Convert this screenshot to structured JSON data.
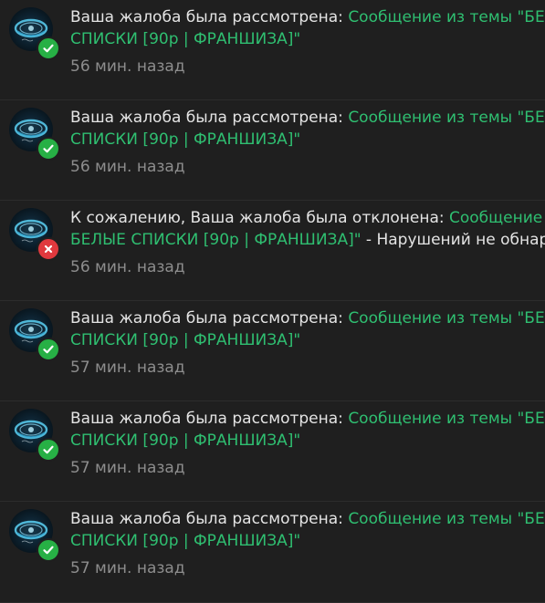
{
  "colors": {
    "background": "#1f1f1f",
    "divider": "#2c2c2c",
    "text": "#e4e4e4",
    "link": "#2fbf71",
    "time": "#8d8d8d",
    "status_ok": "#27b045",
    "status_rejected": "#e0393e"
  },
  "notifications": [
    {
      "status": "accepted",
      "status_icon": "check-icon",
      "lead": "Ваша жалоба была рассмотрена: ",
      "link_line1": "Сообщение из темы \"БЕЛЫЕ",
      "link_line2": "СПИСКИ [90р | ФРАНШИЗА]\"",
      "tail": "",
      "time": "56 мин. назад"
    },
    {
      "status": "accepted",
      "status_icon": "check-icon",
      "lead": "Ваша жалоба была рассмотрена: ",
      "link_line1": "Сообщение из темы \"БЕЛЫЕ",
      "link_line2": "СПИСКИ [90р | ФРАНШИЗА]\"",
      "tail": "",
      "time": "56 мин. назад"
    },
    {
      "status": "rejected",
      "status_icon": "cross-icon",
      "lead": "К сожалению, Ваша жалоба была отклонена: ",
      "link_line1": "Сообщение из темы",
      "link_line2": "БЕЛЫЕ СПИСКИ [90р | ФРАНШИЗА]\"",
      "tail": " - Нарушений не обнаружено",
      "time": "56 мин. назад"
    },
    {
      "status": "accepted",
      "status_icon": "check-icon",
      "lead": "Ваша жалоба была рассмотрена: ",
      "link_line1": "Сообщение из темы \"БЕЛЫЕ",
      "link_line2": "СПИСКИ [90р | ФРАНШИЗА]\"",
      "tail": "",
      "time": "57 мин. назад"
    },
    {
      "status": "accepted",
      "status_icon": "check-icon",
      "lead": "Ваша жалоба была рассмотрена: ",
      "link_line1": "Сообщение из темы \"БЕЛЫЕ",
      "link_line2": "СПИСКИ [90р | ФРАНШИЗА]\"",
      "tail": "",
      "time": "57 мин. назад"
    },
    {
      "status": "accepted",
      "status_icon": "check-icon",
      "lead": "Ваша жалоба была рассмотрена: ",
      "link_line1": "Сообщение из темы \"БЕЛЫЕ",
      "link_line2": "СПИСКИ [90р | ФРАНШИЗА]\"",
      "tail": "",
      "time": "57 мин. назад"
    }
  ]
}
